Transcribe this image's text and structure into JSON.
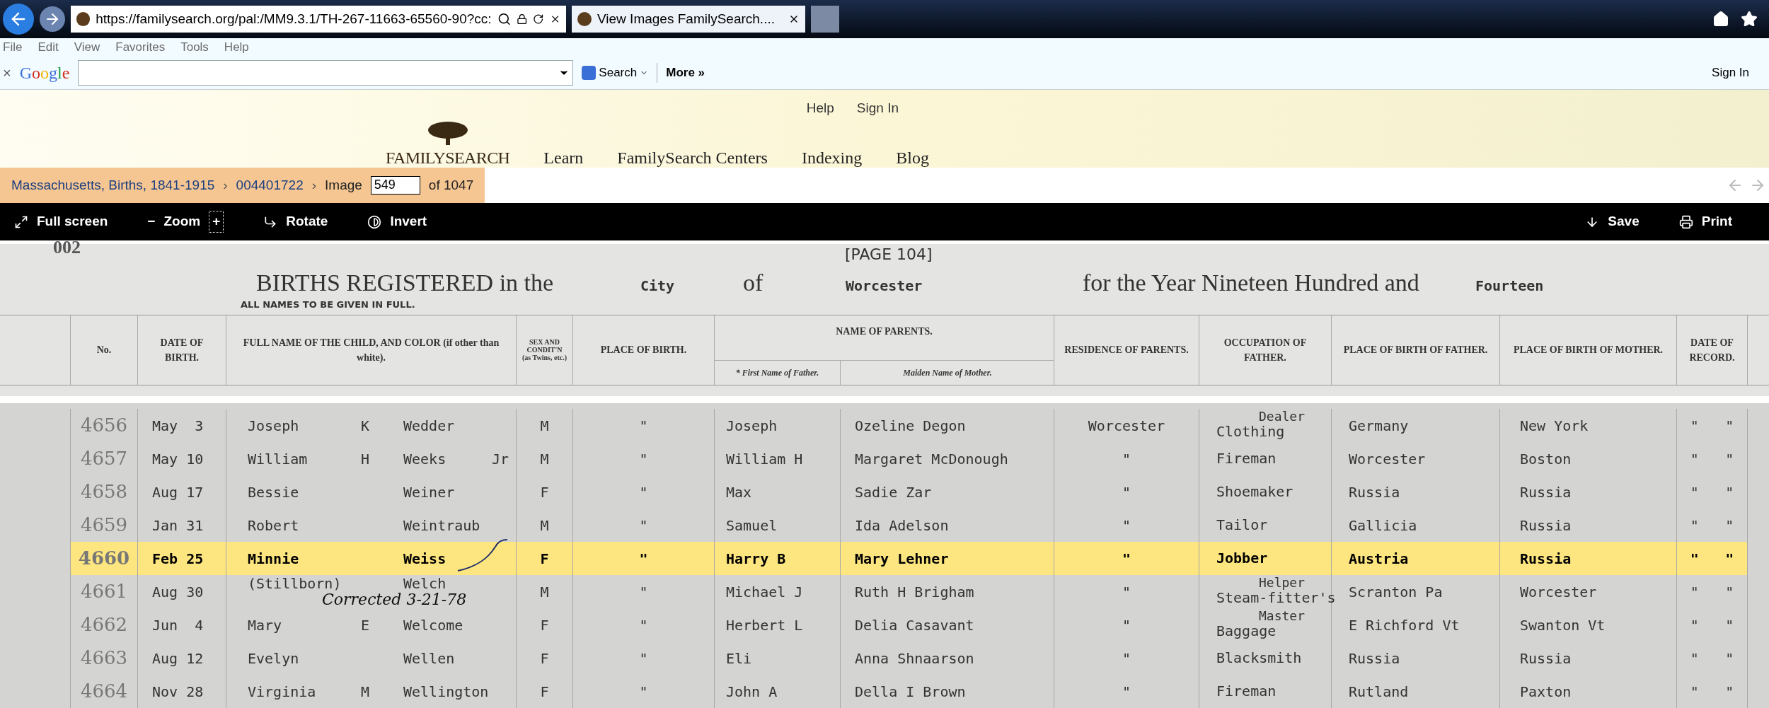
{
  "browser": {
    "address": "https://familysearch.org/pal:/MM9.3.1/TH-267-11663-65560-90?cc:",
    "tab_title": "View Images FamilySearch....",
    "menu": [
      "File",
      "Edit",
      "View",
      "Favorites",
      "Tools",
      "Help"
    ],
    "toolbar": {
      "close": "×",
      "logo": "Google",
      "search": "Search",
      "more": "More »",
      "sign_in": "Sign In"
    }
  },
  "site": {
    "top_links": [
      "Help",
      "Sign In"
    ],
    "logo": "FAMILYSEARCH",
    "nav": [
      "Learn",
      "FamilySearch Centers",
      "Indexing",
      "Blog"
    ],
    "breadcrumb": {
      "collection": "Massachusetts, Births, 1841-1915",
      "film": "004401722",
      "image_label": "Image",
      "image_value": "549",
      "image_total": "of 1047",
      "separator": "›"
    },
    "viewer_tools": [
      {
        "label": "Full screen",
        "kind": "fullscreen"
      },
      {
        "label": "Zoom",
        "kind": "zoom",
        "minus": "−",
        "plus": "+"
      },
      {
        "label": "Rotate",
        "kind": "rotate"
      },
      {
        "label": "Invert",
        "kind": "invert"
      }
    ],
    "viewer_actions": [
      {
        "label": "Save",
        "kind": "save"
      },
      {
        "label": "Print",
        "kind": "print"
      }
    ]
  },
  "document": {
    "corner_number": "002",
    "page": "[PAGE 104]",
    "title_parts": [
      "BIRTHS REGISTERED in the",
      "City",
      "of",
      "Worcester",
      "for the Year Nineteen Hundred and",
      "Fourteen"
    ],
    "note": "ALL NAMES TO BE GIVEN IN FULL.",
    "columns": [
      "No.",
      "DATE OF BIRTH.",
      "FULL NAME OF THE CHILD, AND COLOR (if other than white).",
      "SEX AND CONDIT'N (as Twins, etc.)",
      "PLACE OF BIRTH.",
      "NAME OF PARENTS.",
      "RESIDENCE OF PARENTS.",
      "OCCUPATION OF FATHER.",
      "PLACE OF BIRTH OF FATHER.",
      "PLACE OF BIRTH OF MOTHER.",
      "DATE OF RECORD."
    ],
    "parent_subcolumns": [
      "* First Name of Father.",
      "Maiden Name of Mother."
    ],
    "rows": [
      {
        "number": "4656",
        "date": "May  3",
        "first_name": "Joseph",
        "middle_name": "K",
        "last_name": "Wedder",
        "sex": "M",
        "place_of_birth": "\"",
        "father": "Joseph",
        "mother": "Ozeline Degon",
        "residence": "Worcester",
        "occupation": "Clothing",
        "occupation_note": "Dealer",
        "father_birthplace": "Germany",
        "mother_birthplace": "New York",
        "record": [
          "\"",
          "\""
        ],
        "selected": false
      },
      {
        "number": "4657",
        "date": "May 10",
        "first_name": "William",
        "middle_name": "H",
        "last_name": "Weeks",
        "suffix": "Jr",
        "sex": "M",
        "place_of_birth": "\"",
        "father": "William H",
        "mother": "Margaret McDonough",
        "residence": "\"",
        "occupation": "Fireman",
        "father_birthplace": "Worcester",
        "mother_birthplace": "Boston",
        "record": [
          "\"",
          "\""
        ],
        "selected": false
      },
      {
        "number": "4658",
        "date": "Aug 17",
        "first_name": "Bessie",
        "last_name": "Weiner",
        "sex": "F",
        "place_of_birth": "\"",
        "father": "Max",
        "mother": "Sadie Zar",
        "residence": "\"",
        "occupation": "Shoemaker",
        "father_birthplace": "Russia",
        "mother_birthplace": "Russia",
        "record": [
          "\"",
          "\""
        ],
        "selected": false
      },
      {
        "number": "4659",
        "date": "Jan 31",
        "first_name": "Robert",
        "last_name": "Weintraub",
        "sex": "M",
        "place_of_birth": "\"",
        "father": "Samuel",
        "mother": "Ida Adelson",
        "residence": "\"",
        "occupation": "Tailor",
        "father_birthplace": "Gallicia",
        "mother_birthplace": "Russia",
        "record": [
          "\"",
          "\""
        ],
        "selected": false
      },
      {
        "number": "4660",
        "date": "Feb 25",
        "first_name": "Minnie",
        "last_name": "Weiss",
        "sex": "F",
        "place_of_birth": "\"",
        "father": "Harry B",
        "mother": "Mary Lehner",
        "residence": "\"",
        "occupation": "Jobber",
        "father_birthplace": "Austria",
        "mother_birthplace": "Russia",
        "record": [
          "\"",
          "\""
        ],
        "selected": true
      },
      {
        "number": "4661",
        "date": "Aug 30",
        "first_name": "(Stillborn)",
        "last_name": "Welch",
        "sex": "M",
        "place_of_birth": "\"",
        "father": "Michael J",
        "mother": "Ruth H Brigham",
        "annotation": "Corrected 3-21-78",
        "residence": "\"",
        "occupation": "Steam-fitter's",
        "occupation_note": "Helper",
        "father_birthplace": "Scranton Pa",
        "mother_birthplace": "Worcester",
        "record": [
          "\"",
          "\""
        ],
        "selected": false
      },
      {
        "number": "4662",
        "date": "Jun  4",
        "first_name": "Mary",
        "middle_name": "E",
        "last_name": "Welcome",
        "sex": "F",
        "place_of_birth": "\"",
        "father": "Herbert L",
        "mother": "Delia Casavant",
        "residence": "\"",
        "occupation": "Baggage",
        "occupation_note": "Master",
        "father_birthplace": "E Richford Vt",
        "mother_birthplace": "Swanton Vt",
        "record": [
          "\"",
          "\""
        ],
        "selected": false
      },
      {
        "number": "4663",
        "date": "Aug 12",
        "first_name": "Evelyn",
        "last_name": "Wellen",
        "sex": "F",
        "place_of_birth": "\"",
        "father": "Eli",
        "mother": "Anna Shnaarson",
        "residence": "\"",
        "occupation": "Blacksmith",
        "father_birthplace": "Russia",
        "mother_birthplace": "Russia",
        "record": [
          "\"",
          "\""
        ],
        "selected": false
      },
      {
        "number": "4664",
        "date": "Nov 28",
        "first_name": "Virginia",
        "middle_name": "M",
        "last_name": "Wellington",
        "sex": "F",
        "place_of_birth": "\"",
        "father": "John A",
        "mother": "Della I Brown",
        "residence": "\"",
        "occupation": "Fireman",
        "father_birthplace": "Rutland",
        "mother_birthplace": "Paxton",
        "record": [
          "\"",
          "\""
        ],
        "selected": false
      }
    ]
  }
}
